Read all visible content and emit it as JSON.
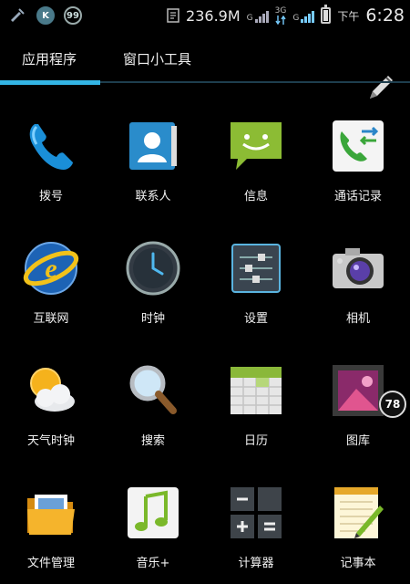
{
  "status_bar": {
    "speed": "236.9M",
    "network_type": "3G",
    "ampm": "下午",
    "time": "6:28",
    "notification_icons": [
      "update-icon",
      "k-icon",
      "99-icon"
    ]
  },
  "tabs": {
    "apps_label": "应用程序",
    "widgets_label": "窗口小工具",
    "active": "apps",
    "accent_color": "#33b5e5"
  },
  "apps": [
    {
      "label": "拨号",
      "icon": "phone-icon"
    },
    {
      "label": "联系人",
      "icon": "contacts-icon"
    },
    {
      "label": "信息",
      "icon": "messaging-icon"
    },
    {
      "label": "通话记录",
      "icon": "call-log-icon"
    },
    {
      "label": "互联网",
      "icon": "browser-icon"
    },
    {
      "label": "时钟",
      "icon": "clock-icon"
    },
    {
      "label": "设置",
      "icon": "settings-icon"
    },
    {
      "label": "相机",
      "icon": "camera-icon"
    },
    {
      "label": "天气时钟",
      "icon": "weather-icon"
    },
    {
      "label": "搜索",
      "icon": "search-icon"
    },
    {
      "label": "日历",
      "icon": "calendar-icon"
    },
    {
      "label": "图库",
      "icon": "gallery-icon"
    },
    {
      "label": "文件管理",
      "icon": "folder-icon"
    },
    {
      "label": "音乐+",
      "icon": "music-icon"
    },
    {
      "label": "计算器",
      "icon": "calculator-icon"
    },
    {
      "label": "记事本",
      "icon": "notepad-icon"
    }
  ],
  "badge": {
    "value": "78"
  }
}
